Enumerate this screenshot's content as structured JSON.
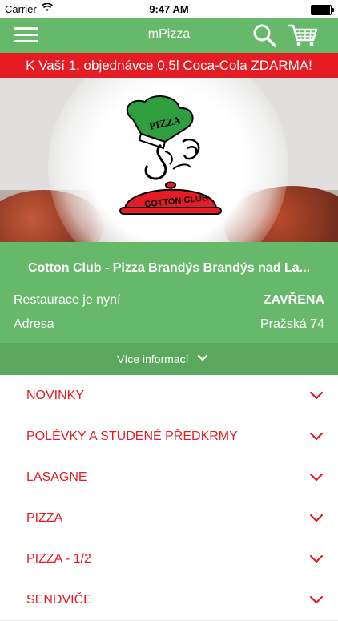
{
  "status_bar": {
    "carrier": "Carrier",
    "time": "9:47 AM"
  },
  "nav": {
    "title": "mPizza"
  },
  "promo": {
    "text": "K Vaší 1. objednávce 0,5l Coca-Cola ZDARMA!"
  },
  "hero": {
    "logo_top_text": "PIZZA",
    "logo_bottom_text": "COTTON CLUB"
  },
  "restaurant": {
    "name": "Cotton Club - Pizza Brandýs Brandýs nad La...",
    "status_label": "Restaurace je nyní",
    "status_value": "ZAVŘENA",
    "address_label": "Adresa",
    "address_value": "Pražská 74"
  },
  "more_info": {
    "label": "Více informací"
  },
  "categories": [
    {
      "label": "NOVINKY"
    },
    {
      "label": "POLÉVKY A STUDENÉ PŘEDKRMY"
    },
    {
      "label": "LASAGNE"
    },
    {
      "label": "PIZZA"
    },
    {
      "label": "PIZZA - 1/2"
    },
    {
      "label": "SENDVIČE"
    }
  ],
  "colors": {
    "green": "#66b86a",
    "dark_green": "#5aa95e",
    "red": "#e51c23"
  }
}
